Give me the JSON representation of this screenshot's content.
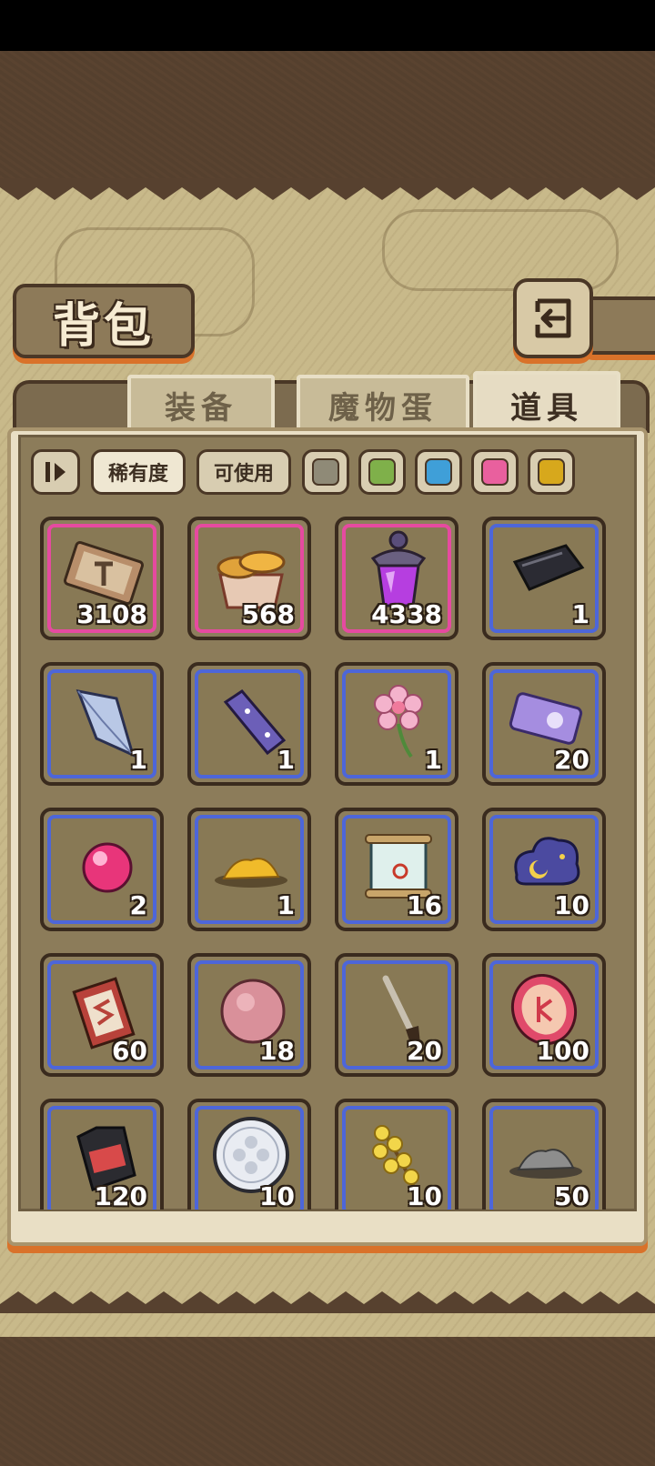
{
  "header": {
    "title": "背包",
    "back_icon": "return-arrow-icon"
  },
  "tabs": [
    {
      "label": "装备",
      "active": false
    },
    {
      "label": "魔物蛋",
      "active": false
    },
    {
      "label": "道具",
      "active": true
    }
  ],
  "filters": {
    "sort_icon": "sort-toggle-icon",
    "rarity_label": "稀有度",
    "usable_label": "可使用",
    "color_filters": [
      {
        "name": "gray",
        "color": "#8f8a77"
      },
      {
        "name": "green",
        "color": "#7fb04a"
      },
      {
        "name": "blue",
        "color": "#3f9fd8"
      },
      {
        "name": "pink",
        "color": "#e9609e"
      },
      {
        "name": "gold",
        "color": "#d7a81c"
      }
    ]
  },
  "items": [
    {
      "icon": "hammer-ticket-icon",
      "qty": "3108",
      "rarity": "pink"
    },
    {
      "icon": "bread-basket-icon",
      "qty": "568",
      "rarity": "pink"
    },
    {
      "icon": "purple-potion-icon",
      "qty": "4338",
      "rarity": "pink"
    },
    {
      "icon": "dark-crystal-shard-icon",
      "qty": "1",
      "rarity": "blue"
    },
    {
      "icon": "ice-crystal-icon",
      "qty": "1",
      "rarity": "blue"
    },
    {
      "icon": "purple-crystal-bar-icon",
      "qty": "1",
      "rarity": "blue"
    },
    {
      "icon": "pink-flower-icon",
      "qty": "1",
      "rarity": "blue"
    },
    {
      "icon": "purple-ticket-icon",
      "qty": "20",
      "rarity": "blue"
    },
    {
      "icon": "pink-orb-icon",
      "qty": "2",
      "rarity": "blue"
    },
    {
      "icon": "gold-powder-icon",
      "qty": "1",
      "rarity": "blue"
    },
    {
      "icon": "scroll-icon",
      "qty": "16",
      "rarity": "blue"
    },
    {
      "icon": "night-cloud-icon",
      "qty": "10",
      "rarity": "blue"
    },
    {
      "icon": "red-card-icon",
      "qty": "60",
      "rarity": "blue"
    },
    {
      "icon": "pink-fur-ball-icon",
      "qty": "18",
      "rarity": "blue"
    },
    {
      "icon": "brush-icon",
      "qty": "20",
      "rarity": "blue"
    },
    {
      "icon": "rune-coin-icon",
      "qty": "100",
      "rarity": "blue"
    },
    {
      "icon": "sd-card-icon",
      "qty": "120",
      "rarity": "blue"
    },
    {
      "icon": "silver-coin-icon",
      "qty": "10",
      "rarity": "blue"
    },
    {
      "icon": "yellow-blossom-icon",
      "qty": "10",
      "rarity": "blue"
    },
    {
      "icon": "gray-powder-icon",
      "qty": "50",
      "rarity": "blue"
    }
  ]
}
